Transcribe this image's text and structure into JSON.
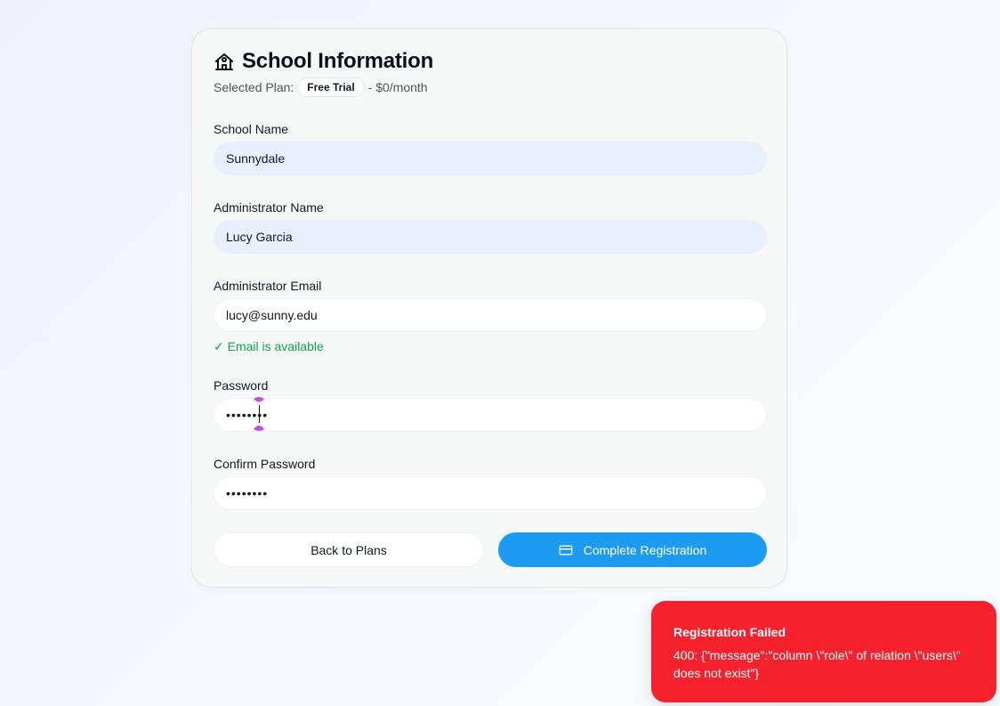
{
  "header": {
    "icon": "school-icon",
    "title": "School Information",
    "plan_prefix": "Selected Plan:",
    "plan_name": "Free Trial",
    "plan_price": "- $0/month"
  },
  "form": {
    "school_name": {
      "label": "School Name",
      "value": "Sunnydale"
    },
    "admin_name": {
      "label": "Administrator Name",
      "value": "Lucy Garcia"
    },
    "admin_email": {
      "label": "Administrator Email",
      "value": "lucy@sunny.edu",
      "status": "✓ Email is available",
      "status_color": "#16a34a"
    },
    "password": {
      "label": "Password",
      "value": "••••••••"
    },
    "confirm_password": {
      "label": "Confirm Password",
      "value": "••••••••"
    }
  },
  "actions": {
    "back_label": "Back to Plans",
    "submit_label": "Complete Registration",
    "submit_icon": "credit-card-icon",
    "primary_color": "#1d9bf0"
  },
  "toast": {
    "title": "Registration Failed",
    "message": "400: {\"message\":\"column \\\"role\\\" of relation \\\"users\\\" does not exist\"}",
    "color": "#f5222d"
  }
}
